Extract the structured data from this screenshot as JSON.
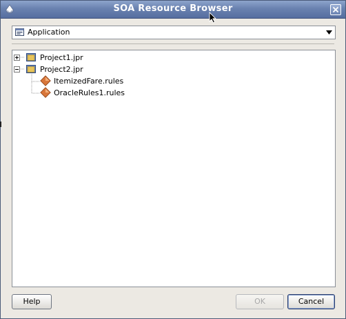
{
  "window": {
    "title": "SOA Resource Browser"
  },
  "combo": {
    "selected": "Application",
    "icon": "application-icon"
  },
  "tree": {
    "items": [
      {
        "label": "Project1.jpr",
        "icon": "folder-icon",
        "expanded": false
      },
      {
        "label": "Project2.jpr",
        "icon": "folder-icon",
        "expanded": true
      },
      {
        "label": "ItemizedFare.rules",
        "icon": "rules-diamond-icon",
        "parent": 1
      },
      {
        "label": "OracleRules1.rules",
        "icon": "rules-diamond-icon",
        "parent": 1
      }
    ]
  },
  "buttons": {
    "help": "Help",
    "ok": "OK",
    "cancel": "Cancel"
  },
  "colors": {
    "titlebar": "#6a82b0",
    "dialog_bg": "#ece9e3",
    "folder": "#e8c45a",
    "rules": "#d8763a"
  }
}
